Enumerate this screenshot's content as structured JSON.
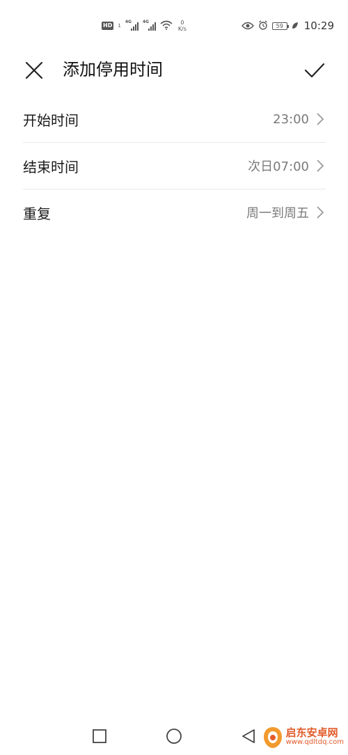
{
  "status_bar": {
    "hd_label": "HD",
    "sim_label": "1",
    "net1": "4G",
    "net2": "4G",
    "speed_value": "0",
    "speed_unit": "K/s",
    "battery": "59",
    "time": "10:29"
  },
  "header": {
    "title": "添加停用时间",
    "close_icon": "close-icon",
    "confirm_icon": "check-icon"
  },
  "settings": [
    {
      "label": "开始时间",
      "value": "23:00"
    },
    {
      "label": "结束时间",
      "value": "次日07:00"
    },
    {
      "label": "重复",
      "value": "周一到周五"
    }
  ],
  "nav": {
    "recent_icon": "square-icon",
    "home_icon": "circle-icon",
    "back_icon": "triangle-back-icon"
  },
  "watermark": {
    "title": "启东安卓网",
    "url": "www.qdltdq.com"
  },
  "colors": {
    "accent_watermark": "#e25b2a",
    "value_gray": "#7a7a7a",
    "divider": "#e8e8e8"
  }
}
